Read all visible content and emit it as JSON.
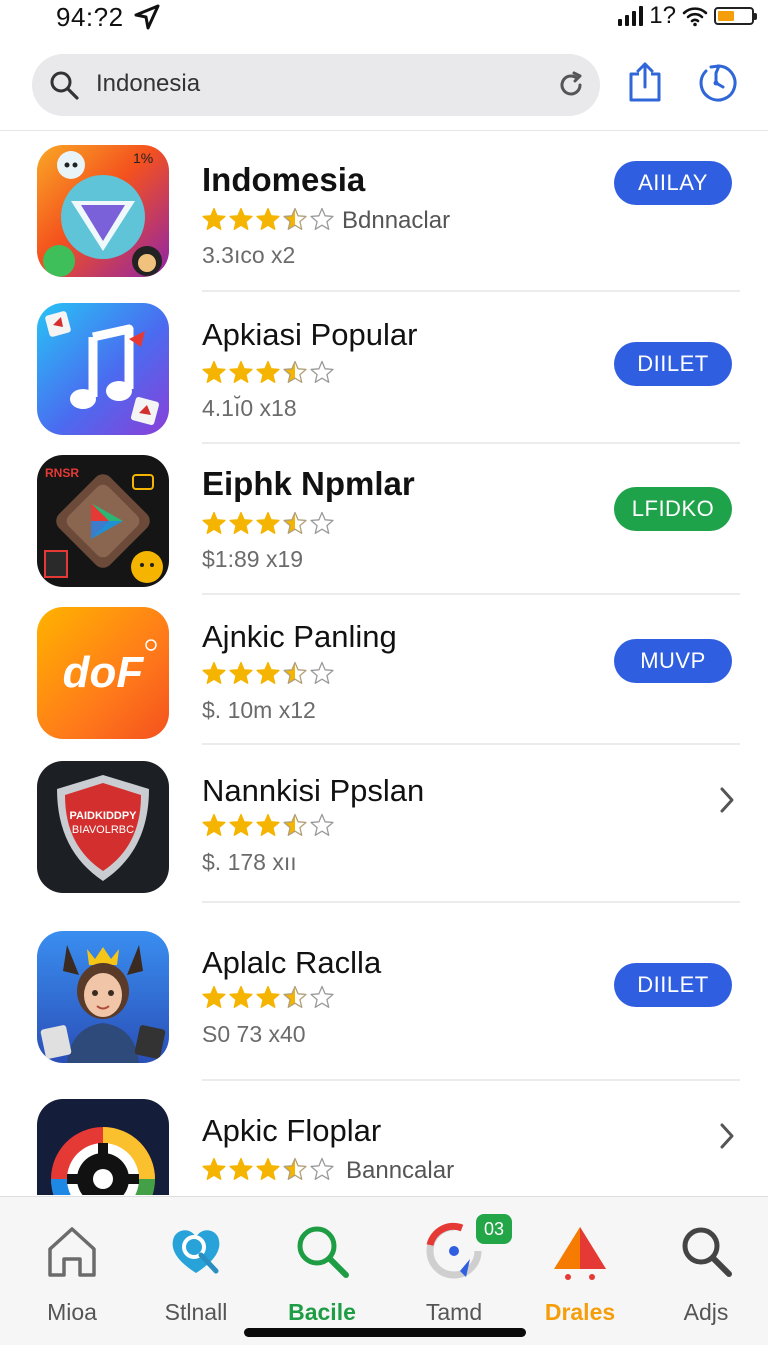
{
  "status_bar": {
    "time": "94:?2",
    "battery_text": "1?",
    "battery_level": 0.5,
    "battery_color": "#f59e0b"
  },
  "search": {
    "query": "Indonesia"
  },
  "apps": [
    {
      "name": "Indomesia",
      "rating_label": "Bdnnaclar",
      "meta": "3.3ıco  x2",
      "action": "AIILAY",
      "stars": 3.5,
      "icon": "colorful-folder-app-icon"
    },
    {
      "name": "Apkiasi Popular",
      "rating_label": "",
      "meta": "4.1ı̆0  x18",
      "action": "DIILET",
      "stars": 3.5,
      "icon": "music-note-app-icon"
    },
    {
      "name": "Eiphk Npmlar",
      "rating_label": "",
      "meta": "$1:89  x19",
      "action": "LFIDKO",
      "stars": 3.5,
      "icon": "play-store-game-icon"
    },
    {
      "name": "Ajnkic Panling",
      "rating_label": "",
      "meta": "$. 10m   x12",
      "action": "MUVP",
      "stars": 3.5,
      "icon": "dori-logo-app-icon"
    },
    {
      "name": "Nannkisi Ppslan",
      "rating_label": "",
      "meta": "$. 178  xıı",
      "action": "",
      "stars": 3.5,
      "icon": "shield-app-icon"
    },
    {
      "name": "Aplalc Raclla",
      "rating_label": "",
      "meta": "S0 73  x40",
      "action": "DIILET",
      "stars": 3.5,
      "icon": "avatar-game-icon"
    },
    {
      "name": "Apkic Floplar",
      "rating_label": "Banncalar",
      "meta": "",
      "action": "",
      "stars": 3.5,
      "icon": "gear-wheel-app-icon"
    }
  ],
  "tabs": [
    {
      "label": "Mioa",
      "icon": "home-icon"
    },
    {
      "label": "Stlnall",
      "icon": "search-heart-icon"
    },
    {
      "label": "Bacile",
      "icon": "search-icon"
    },
    {
      "label": "Tamd",
      "icon": "swirl-icon",
      "badge": "03"
    },
    {
      "label": "Drales",
      "icon": "triangle-icon"
    },
    {
      "label": "Adjs",
      "icon": "magnifier-icon"
    }
  ],
  "colors": {
    "accent_blue": "#2f5fe0",
    "accent_green": "#1fa34a",
    "star": "#f5b400"
  }
}
